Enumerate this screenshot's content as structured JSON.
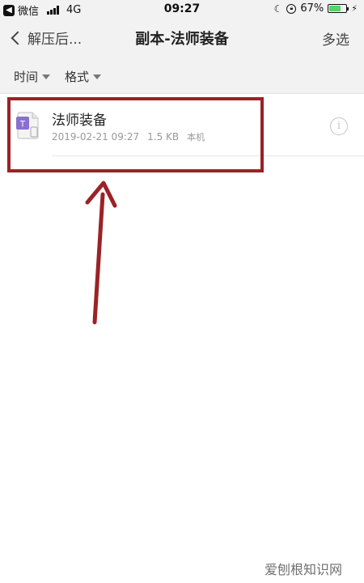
{
  "status_bar": {
    "carrier": "微信",
    "network": "4G",
    "time": "09:27",
    "battery": "67%",
    "battery_level": 0.67
  },
  "nav": {
    "back_label": "解压后...",
    "title": "副本-法师装备",
    "multi_select_label": "多选"
  },
  "filters": {
    "time_label": "时间",
    "format_label": "格式"
  },
  "file": {
    "icon_letter": "T",
    "name": "法师装备",
    "date": "2019-02-21 09:27",
    "size": "1.5 KB",
    "location": "本机"
  },
  "watermark": "爱刨根知识网",
  "colors": {
    "annotation": "#9b2226",
    "file_icon_accent": "#8a6fd1",
    "battery_fill": "#4cd964"
  }
}
